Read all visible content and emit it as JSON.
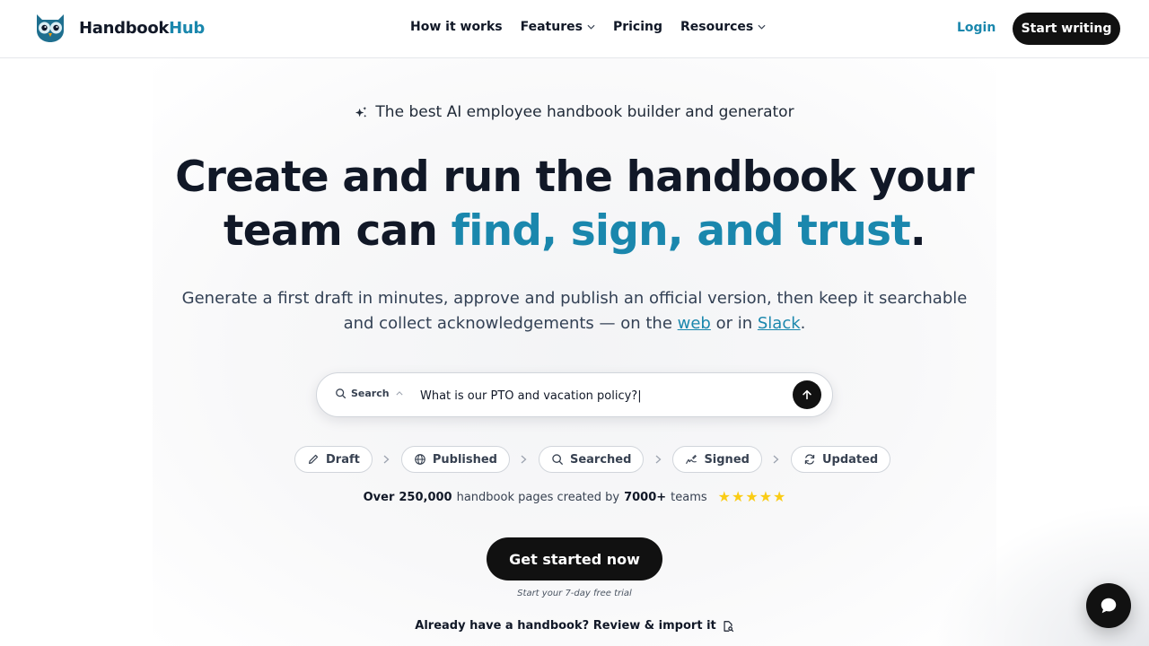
{
  "brand": {
    "name_part1": "Handbook",
    "name_part2": "Hub",
    "accent_color": "#1a87ad"
  },
  "nav": {
    "items": [
      {
        "label": "How it works",
        "dropdown": false
      },
      {
        "label": "Features",
        "dropdown": true
      },
      {
        "label": "Pricing",
        "dropdown": false
      },
      {
        "label": "Resources",
        "dropdown": true
      }
    ],
    "login_label": "Login",
    "start_label": "Start writing"
  },
  "hero": {
    "tagline": "The best AI employee handbook builder and generator",
    "title_line1": "Create and run the handbook your",
    "title_line2_plain": "team can ",
    "title_line2_accent": "find, sign, and trust",
    "title_line2_end": ".",
    "subtitle_part1": "Generate a first draft in minutes, approve and publish an official version, then keep it searchable and collect acknowledgements — on the ",
    "subtitle_link1": "web",
    "subtitle_part2": " or in ",
    "subtitle_link2": "Slack",
    "subtitle_part3": "."
  },
  "search": {
    "mode_label": "Search",
    "value": "What is our PTO and vacation policy?|"
  },
  "steps": [
    {
      "label": "Draft",
      "icon": "pencil-icon"
    },
    {
      "label": "Published",
      "icon": "globe-icon"
    },
    {
      "label": "Searched",
      "icon": "search-icon"
    },
    {
      "label": "Signed",
      "icon": "signature-icon"
    },
    {
      "label": "Updated",
      "icon": "refresh-icon"
    }
  ],
  "social_proof": {
    "prefix": "Over",
    "pages_count": "250,000",
    "middle": "handbook pages created by",
    "teams_count": "7000+",
    "suffix": "teams",
    "rating_stars": 5,
    "star_color": "#facc15"
  },
  "cta": {
    "label": "Get started now",
    "trial_note": "Start your 7-day free trial",
    "import_label": "Already have a handbook? Review & import it"
  }
}
